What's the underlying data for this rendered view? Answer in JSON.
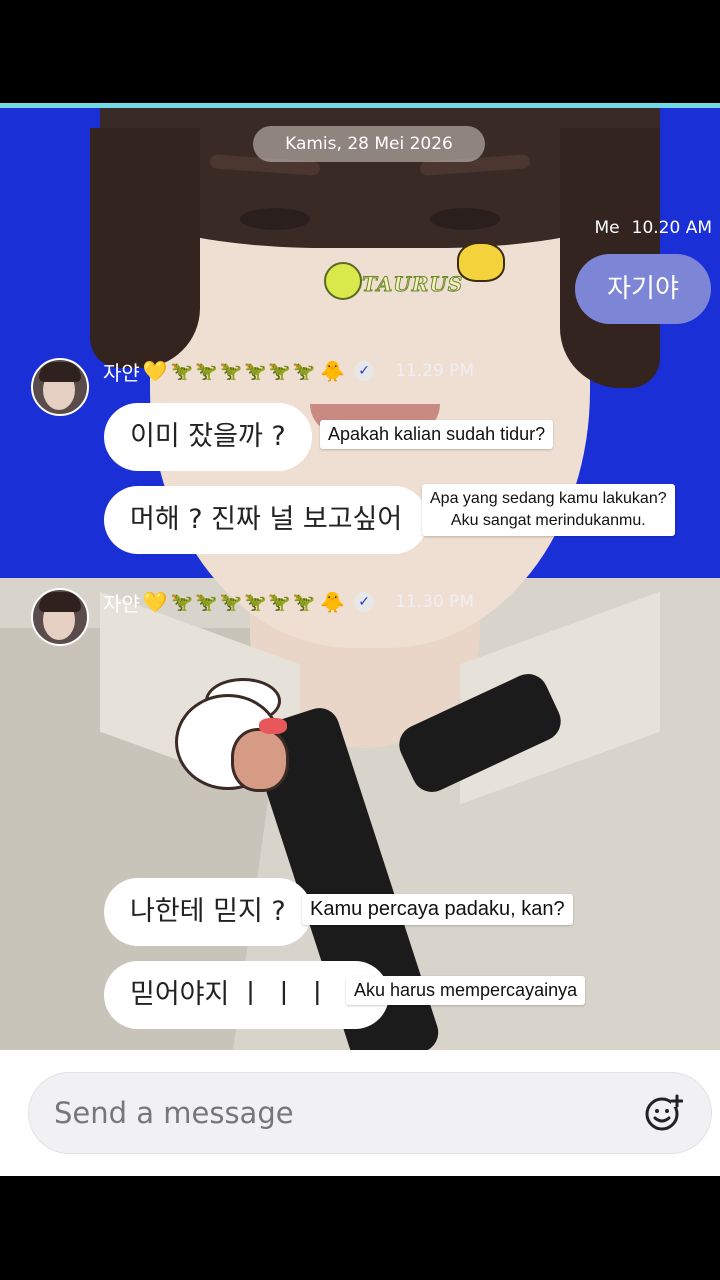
{
  "conversation": {
    "date_label": "Kamis, 28 Mei 2026",
    "me": {
      "name": "Me",
      "time": "10.20 AM",
      "message": "자기야"
    },
    "sticker_text": "TAURUS",
    "groups": [
      {
        "sender": "자얀",
        "heart": "💛",
        "dinos": "🦖🦖🦖🦖🦖🦖",
        "duck": "🐥",
        "time": "11.29 PM",
        "messages": [
          {
            "text": "이미 잤을까 ?",
            "translation": "Apakah kalian sudah tidur?"
          },
          {
            "text": "머해 ? 진짜 널 보고싶어",
            "translation": "Apa yang sedang kamu lakukan?\nAku sangat merindukanmu."
          }
        ]
      },
      {
        "sender": "자얀",
        "heart": "💛",
        "dinos": "🦖🦖🦖🦖🦖🦖",
        "duck": "🐥",
        "time": "11.30 PM",
        "messages": [
          {
            "text": "나한테 믿지 ?",
            "translation": "Kamu percaya padaku, kan?"
          },
          {
            "text": "믿어야지 ㅣ ㅣ ㅣ ㅣ",
            "translation": "Aku harus mempercayainya"
          }
        ]
      }
    ]
  },
  "composer": {
    "placeholder": "Send a message",
    "emoji_button_icon": "emoji-add-icon"
  },
  "colors": {
    "chat_bg": "#1a2fd6",
    "accent": "#6fd9e6",
    "me_bubble": "#7d86d6"
  }
}
